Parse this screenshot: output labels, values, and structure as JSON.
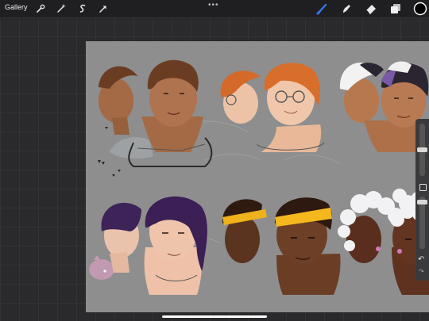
{
  "topbar": {
    "gallery_label": "Gallery",
    "more_label": "•••",
    "icons": [
      "wrench-icon",
      "magic-wand-icon",
      "selection-icon",
      "transform-arrow-icon"
    ],
    "right_icons": [
      "brush-icon",
      "smudge-icon",
      "eraser-icon",
      "layers-icon",
      "color-swatch"
    ],
    "brush_active_color": "#2f7bf5",
    "current_color": "#000000"
  },
  "sidebar": {
    "undo_label": "↶",
    "redo_label": "↷"
  }
}
